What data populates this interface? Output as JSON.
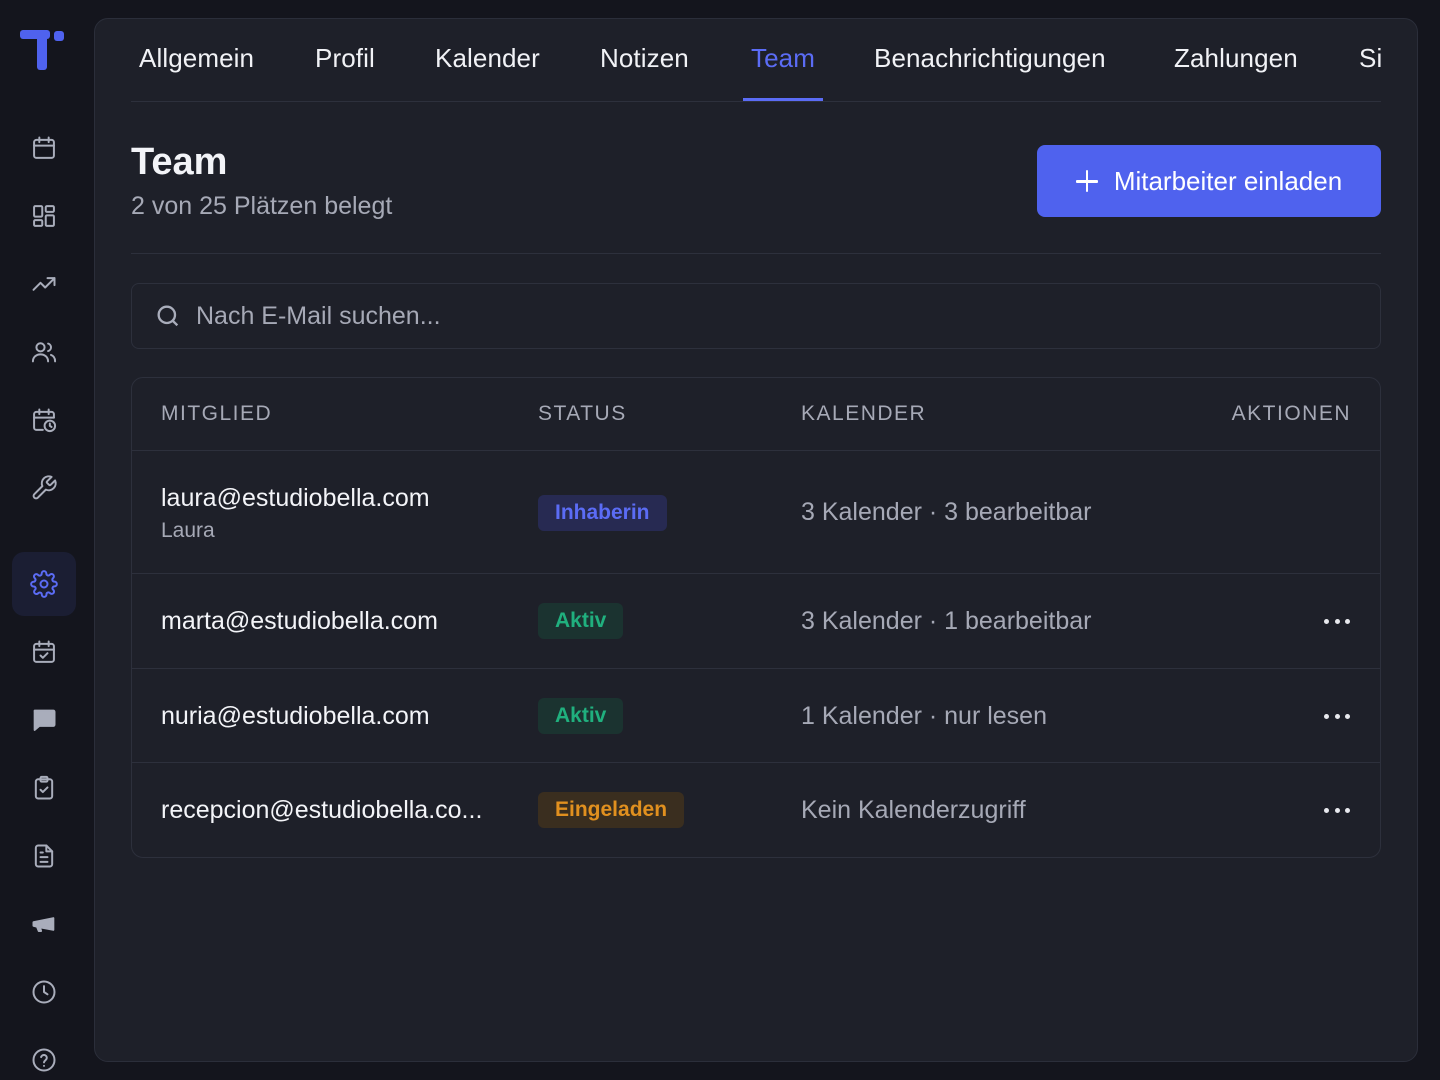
{
  "colors": {
    "accent": "#5b6cf5",
    "active_green": "#20b07e",
    "invited_orange": "#e1901f",
    "background": "#1e2029"
  },
  "sidebar": {
    "items": [
      {
        "icon": "calendar-icon"
      },
      {
        "icon": "dashboard-grid-icon"
      },
      {
        "icon": "trending-up-icon"
      },
      {
        "icon": "users-icon"
      },
      {
        "icon": "calendar-clock-icon"
      },
      {
        "icon": "wrench-icon"
      },
      {
        "icon": "gear-icon",
        "active": true
      },
      {
        "icon": "calendar-check-icon"
      },
      {
        "icon": "chat-bubble-icon"
      },
      {
        "icon": "clipboard-check-icon"
      },
      {
        "icon": "document-icon"
      },
      {
        "icon": "megaphone-icon"
      },
      {
        "icon": "clock-icon"
      },
      {
        "icon": "help-circle-icon"
      }
    ]
  },
  "tabs": [
    {
      "label": "Allgemein"
    },
    {
      "label": "Profil"
    },
    {
      "label": "Kalender"
    },
    {
      "label": "Notizen"
    },
    {
      "label": "Team",
      "active": true
    },
    {
      "label": "Benachrichtigungen"
    },
    {
      "label": "Zahlungen"
    },
    {
      "label": "Siche"
    }
  ],
  "header": {
    "title": "Team",
    "subtitle": "2 von 25 Plätzen belegt",
    "invite_label": "Mitarbeiter einladen"
  },
  "search": {
    "placeholder": "Nach E-Mail suchen..."
  },
  "table": {
    "columns": [
      "MITGLIED",
      "STATUS",
      "KALENDER",
      "AKTIONEN"
    ],
    "rows": [
      {
        "email": "laura@estudiobella.com",
        "name": "Laura",
        "status": "Inhaberin",
        "calendar": "3 Kalender · 3 bearbeitbar"
      },
      {
        "email": "marta@estudiobella.com",
        "status": "Aktiv",
        "calendar": "3 Kalender · 1 bearbeitbar"
      },
      {
        "email": "nuria@estudiobella.com",
        "status": "Aktiv",
        "calendar": "1 Kalender · nur lesen"
      },
      {
        "email": "recepcion@estudiobella.co...",
        "status": "Eingeladen",
        "calendar": "Kein Kalenderzugriff"
      }
    ]
  }
}
